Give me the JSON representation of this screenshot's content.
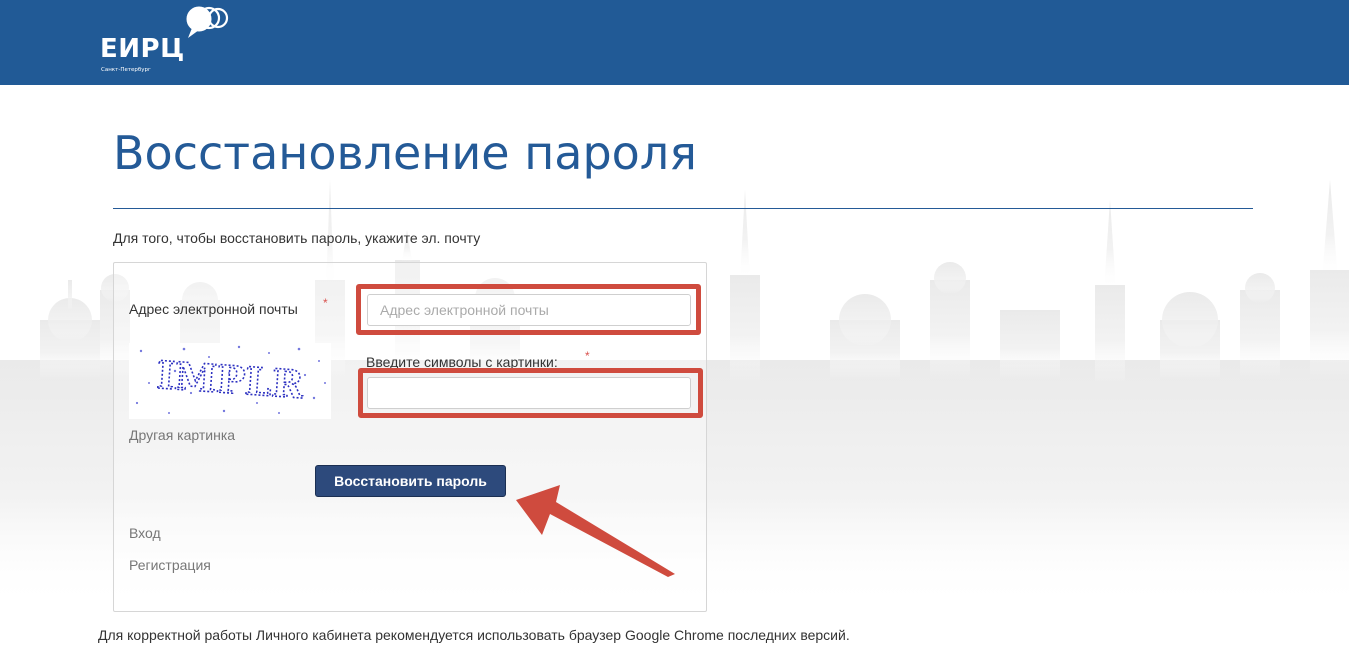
{
  "header": {
    "logo_text": "ЕИРЦ",
    "logo_subtext": "Санкт-Петербург",
    "background_color": "#215a96"
  },
  "page": {
    "title": "Восстановление пароля",
    "intro": "Для того, чтобы восстановить пароль, укажите эл. почту"
  },
  "form": {
    "email_label": "Адрес электронной почты",
    "email_placeholder": "Адрес электронной почты",
    "email_value": "",
    "required_mark": "*",
    "captcha_label": "Введите символы с картинки:",
    "captcha_text": "IMPLR",
    "captcha_value": "",
    "refresh_captcha_link": "Другая картинка",
    "submit_label": "Восстановить пароль",
    "highlight_color": "#cf4b3e"
  },
  "links": {
    "login": "Вход",
    "register": "Регистрация"
  },
  "footer": {
    "note": "Для корректной работы Личного кабинета рекомендуется использовать браузер Google Chrome последних версий."
  }
}
